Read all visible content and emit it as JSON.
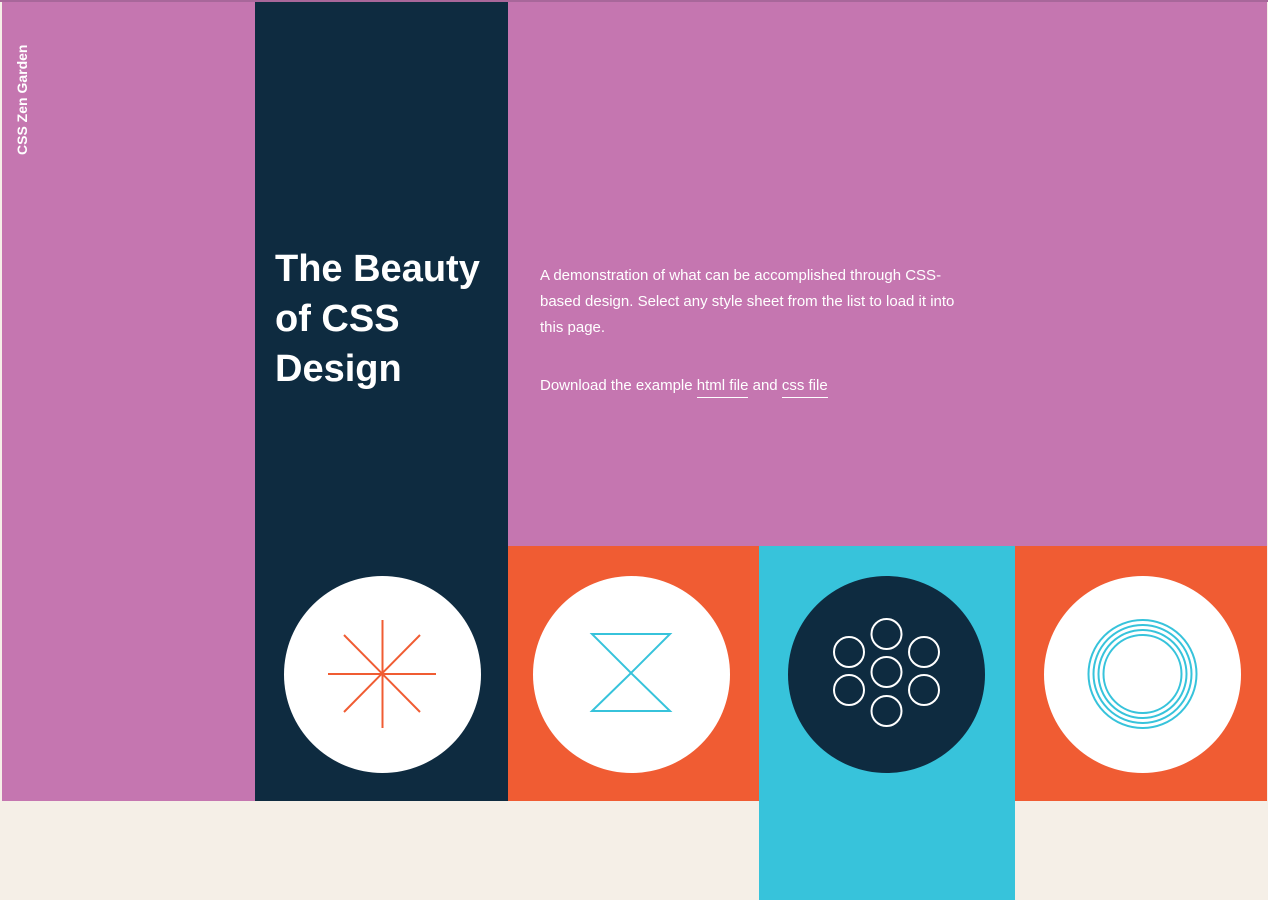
{
  "header": {
    "site_name": "CSS Zen Garden",
    "title": "The Beauty of CSS Design"
  },
  "intro": {
    "text": "A demonstration of what can be accomplished through CSS-based design. Select any style sheet from the list to load it into this page."
  },
  "download": {
    "prefix": "Download the example",
    "html_link": "html file",
    "conjunction": "and",
    "css_link": "css file"
  },
  "icons": [
    {
      "name": "asterisk-icon",
      "color": "#f05c33",
      "bg": "#ffffff"
    },
    {
      "name": "hourglass-icon",
      "color": "#37c3db",
      "bg": "#ffffff"
    },
    {
      "name": "seven-circles-icon",
      "color": "#ffffff",
      "bg": "#0e2b40"
    },
    {
      "name": "concentric-rings-icon",
      "color": "#37c3db",
      "bg": "#ffffff"
    }
  ],
  "colors": {
    "pink": "#c576b0",
    "navy": "#0e2b40",
    "orange": "#f05c33",
    "cyan": "#37c3db",
    "cream": "#f5efe7",
    "white": "#ffffff"
  }
}
